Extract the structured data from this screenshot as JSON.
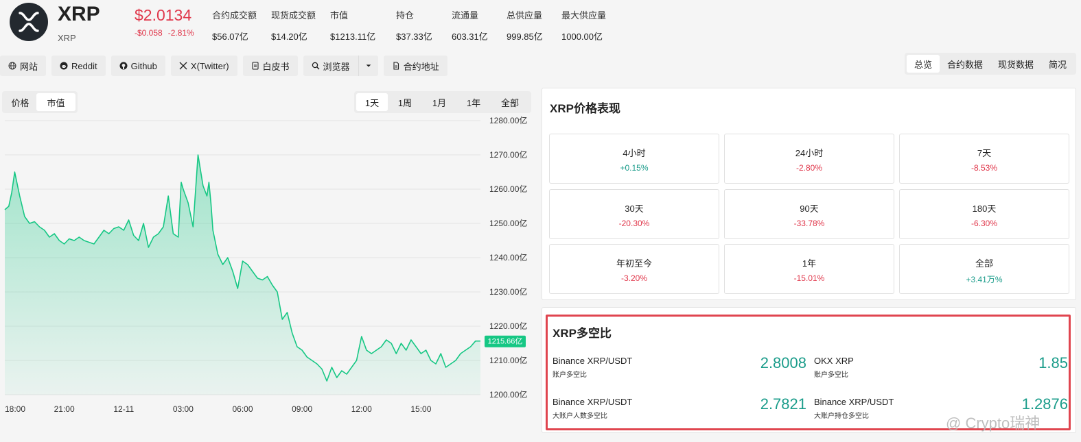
{
  "coin": {
    "name": "XRP",
    "subtitle": "XRP",
    "price": "$2.0134",
    "change_abs": "-$0.058",
    "change_pct": "-2.81%",
    "icon": "xrp-logo"
  },
  "stats": [
    {
      "label": "合约成交额",
      "value": "$56.07亿"
    },
    {
      "label": "现货成交额",
      "value": "$14.20亿"
    },
    {
      "label": "市值",
      "value": "$1213.11亿"
    },
    {
      "label": "持仓",
      "value": "$37.33亿"
    },
    {
      "label": "流通量",
      "value": "603.31亿"
    },
    {
      "label": "总供应量",
      "value": "999.85亿"
    },
    {
      "label": "最大供应量",
      "value": "1000.00亿"
    }
  ],
  "links": {
    "website": "网站",
    "reddit": "Reddit",
    "github": "Github",
    "twitter": "X(Twitter)",
    "whitepaper": "白皮书",
    "explorer": "浏览器",
    "contract": "合约地址"
  },
  "view_tabs": [
    "总览",
    "合约数据",
    "现货数据",
    "简况"
  ],
  "chart_toggle": [
    "价格",
    "市值"
  ],
  "range_tabs": [
    "1天",
    "1周",
    "1月",
    "1年",
    "全部"
  ],
  "chart_data": {
    "type": "area",
    "ylabel": "",
    "ylim": [
      1200,
      1280
    ],
    "y_ticks": [
      "1280.00亿",
      "1270.00亿",
      "1260.00亿",
      "1250.00亿",
      "1240.00亿",
      "1230.00亿",
      "1220.00亿",
      "1210.00亿",
      "1200.00亿"
    ],
    "x_ticks": [
      "18:00",
      "21:00",
      "12-11",
      "03:00",
      "06:00",
      "09:00",
      "12:00",
      "15:00"
    ],
    "x_tick_hours": [
      0,
      3,
      6,
      9,
      12,
      15,
      18,
      21
    ],
    "current_label": "1215.66亿",
    "series": [
      {
        "x": [
          0,
          0.2,
          0.35,
          0.5,
          0.75,
          1.0,
          1.25,
          1.5,
          1.75,
          2.0,
          2.25,
          2.5,
          2.75,
          3.0,
          3.25,
          3.5,
          3.75,
          4.0,
          4.25,
          4.5,
          4.75,
          5.0,
          5.25,
          5.5,
          5.75,
          6.0,
          6.25,
          6.5,
          6.75,
          7.0,
          7.25,
          7.5,
          7.75,
          8.0,
          8.25,
          8.5,
          8.75,
          8.9,
          9.0,
          9.25,
          9.5,
          9.75,
          10.0,
          10.2,
          10.3,
          10.4,
          10.5,
          10.75,
          11.0,
          11.25,
          11.5,
          11.75,
          12.0,
          12.25,
          12.5,
          12.75,
          13.0,
          13.25,
          13.5,
          13.75,
          14.0,
          14.25,
          14.5,
          14.75,
          15.0,
          15.25,
          15.5,
          15.75,
          16.0,
          16.25,
          16.5,
          16.75,
          17.0,
          17.25,
          17.5,
          17.75,
          18.0,
          18.25,
          18.5,
          18.75,
          19.0,
          19.25,
          19.5,
          19.75,
          20.0,
          20.25,
          20.5,
          20.75,
          21.0,
          21.25,
          21.5,
          21.75,
          22.0,
          22.25,
          22.5,
          22.75,
          23.0,
          23.25,
          23.5,
          23.75,
          24.0
        ],
        "values": [
          1254,
          1255,
          1259,
          1265,
          1258,
          1252,
          1250,
          1250.5,
          1249,
          1248,
          1246,
          1247,
          1245,
          1244,
          1245.5,
          1245,
          1246,
          1245,
          1244.5,
          1244,
          1246,
          1248,
          1247,
          1248.5,
          1249,
          1248,
          1251,
          1246.5,
          1245,
          1250,
          1243,
          1246,
          1247,
          1249,
          1258,
          1247,
          1246,
          1262,
          1260,
          1256,
          1249,
          1270,
          1261,
          1258,
          1262,
          1256,
          1248,
          1241,
          1238,
          1240,
          1236,
          1231,
          1239,
          1238,
          1236,
          1234,
          1233.5,
          1234.5,
          1232,
          1230,
          1222,
          1224,
          1218,
          1214,
          1213,
          1211,
          1210,
          1209,
          1207.5,
          1204,
          1208,
          1205,
          1207,
          1206,
          1208,
          1210,
          1217,
          1213,
          1212,
          1213,
          1214,
          1216,
          1215,
          1212,
          1215,
          1213,
          1216,
          1214,
          1212,
          1213,
          1210,
          1209,
          1212,
          1208,
          1209,
          1210,
          1212,
          1213,
          1214,
          1215.66,
          1215.66
        ]
      }
    ]
  },
  "performance": {
    "title": "XRP价格表现",
    "items": [
      {
        "label": "4小时",
        "value": "+0.15%",
        "dir": "pos"
      },
      {
        "label": "24小时",
        "value": "-2.80%",
        "dir": "neg"
      },
      {
        "label": "7天",
        "value": "-8.53%",
        "dir": "neg"
      },
      {
        "label": "30天",
        "value": "-20.30%",
        "dir": "neg"
      },
      {
        "label": "90天",
        "value": "-33.78%",
        "dir": "neg"
      },
      {
        "label": "180天",
        "value": "-6.30%",
        "dir": "neg"
      },
      {
        "label": "年初至今",
        "value": "-3.20%",
        "dir": "neg"
      },
      {
        "label": "1年",
        "value": "-15.01%",
        "dir": "neg"
      },
      {
        "label": "全部",
        "value": "+3.41万%",
        "dir": "pos"
      }
    ]
  },
  "ratio": {
    "title": "XRP多空比",
    "items": [
      {
        "name": "Binance XRP/USDT",
        "sub": "账户多空比",
        "value": "2.8008"
      },
      {
        "name": "OKX XRP",
        "sub": "账户多空比",
        "value": "1.85"
      },
      {
        "name": "Binance XRP/USDT",
        "sub": "大账户人数多空比",
        "value": "2.7821"
      },
      {
        "name": "Binance XRP/USDT",
        "sub": "大账户持仓多空比",
        "value": "1.2876"
      }
    ]
  },
  "colors": {
    "accent_green": "#1a9c8a",
    "line_green": "#16c784",
    "negative_red": "#e0364a",
    "highlight_red": "#e0454f"
  },
  "watermark": "@ Crypto瑞神"
}
